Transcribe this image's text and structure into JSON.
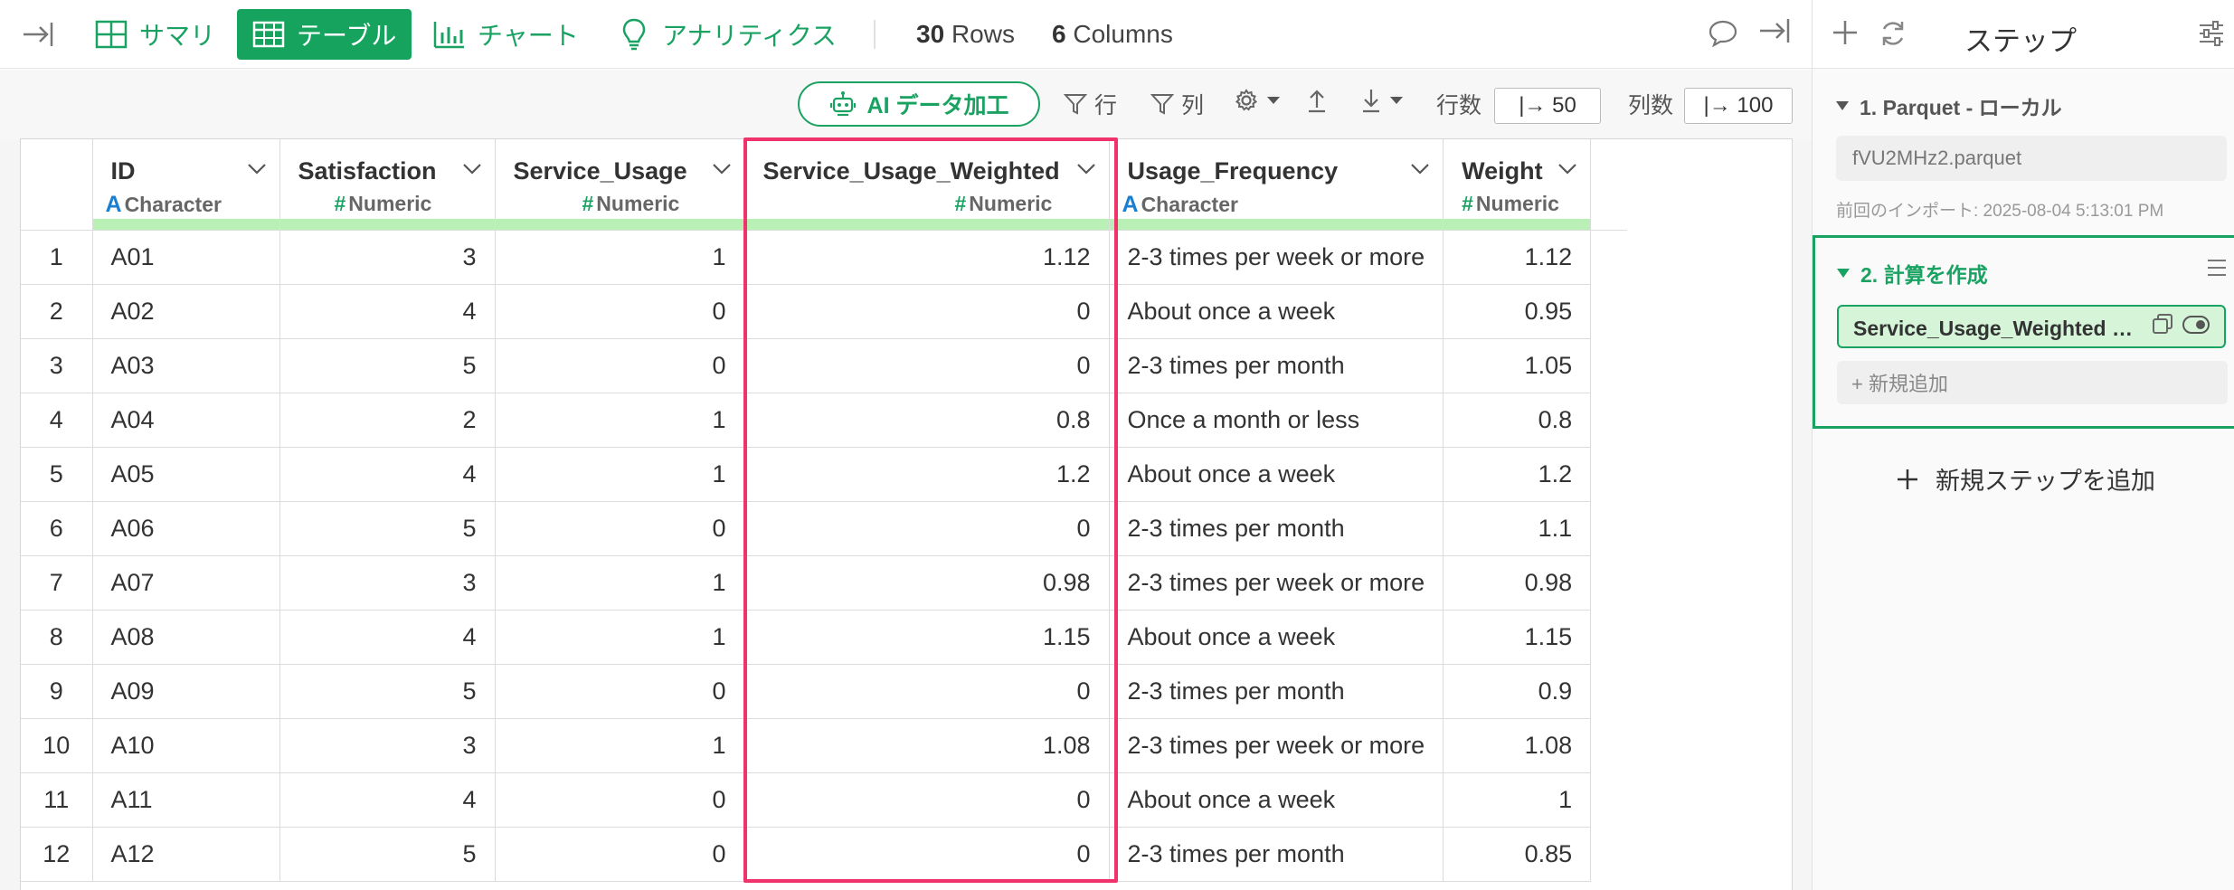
{
  "nav": {
    "tabs": [
      {
        "label": "サマリ",
        "icon": "summary-grid-icon"
      },
      {
        "label": "テーブル",
        "icon": "table-icon",
        "active": true
      },
      {
        "label": "チャート",
        "icon": "bar-chart-icon"
      },
      {
        "label": "アナリティクス",
        "icon": "lightbulb-icon"
      }
    ],
    "rows_count": "30",
    "rows_label": "Rows",
    "cols_count": "6",
    "cols_label": "Columns"
  },
  "toolbar": {
    "ai_label": "AI データ加工",
    "row_filter": "行",
    "col_filter": "列",
    "rows_label": "行数",
    "rows_value": "|→ 50",
    "cols_label": "列数",
    "cols_value": "|→ 100"
  },
  "table": {
    "columns": [
      {
        "name": "ID",
        "type": "Character",
        "type_glyph": "A"
      },
      {
        "name": "Satisfaction",
        "type": "Numeric",
        "type_glyph": "#"
      },
      {
        "name": "Service_Usage",
        "type": "Numeric",
        "type_glyph": "#"
      },
      {
        "name": "Service_Usage_Weighted",
        "type": "Numeric",
        "type_glyph": "#"
      },
      {
        "name": "Usage_Frequency",
        "type": "Character",
        "type_glyph": "A"
      },
      {
        "name": "Weight",
        "type": "Numeric",
        "type_glyph": "#"
      }
    ],
    "rows": [
      [
        "1",
        "A01",
        "3",
        "1",
        "1.12",
        "2-3 times per week or more",
        "1.12"
      ],
      [
        "2",
        "A02",
        "4",
        "0",
        "0",
        "About once a week",
        "0.95"
      ],
      [
        "3",
        "A03",
        "5",
        "0",
        "0",
        "2-3 times per month",
        "1.05"
      ],
      [
        "4",
        "A04",
        "2",
        "1",
        "0.8",
        "Once a month or less",
        "0.8"
      ],
      [
        "5",
        "A05",
        "4",
        "1",
        "1.2",
        "About once a week",
        "1.2"
      ],
      [
        "6",
        "A06",
        "5",
        "0",
        "0",
        "2-3 times per month",
        "1.1"
      ],
      [
        "7",
        "A07",
        "3",
        "1",
        "0.98",
        "2-3 times per week or more",
        "0.98"
      ],
      [
        "8",
        "A08",
        "4",
        "1",
        "1.15",
        "About once a week",
        "1.15"
      ],
      [
        "9",
        "A09",
        "5",
        "0",
        "0",
        "2-3 times per month",
        "0.9"
      ],
      [
        "10",
        "A10",
        "3",
        "1",
        "1.08",
        "2-3 times per week or more",
        "1.08"
      ],
      [
        "11",
        "A11",
        "4",
        "0",
        "0",
        "About once a week",
        "1"
      ],
      [
        "12",
        "A12",
        "5",
        "0",
        "0",
        "2-3 times per month",
        "0.85"
      ]
    ]
  },
  "panel": {
    "title": "ステップ",
    "step1_title": "1. Parquet - ローカル",
    "step1_file": "fVU2MHz2.parquet",
    "step1_import": "前回のインポート: 2025-08-04 5:13:01 PM",
    "step2_title": "2. 計算を作成",
    "step2_chip": "Service_Usage_Weighted の作成",
    "step2_add": "+ 新規追加",
    "new_step": "新規ステップを追加"
  },
  "colors": {
    "accent": "#1aa262",
    "highlight": "#f0336c",
    "type_bar": "#b9f0b5"
  }
}
